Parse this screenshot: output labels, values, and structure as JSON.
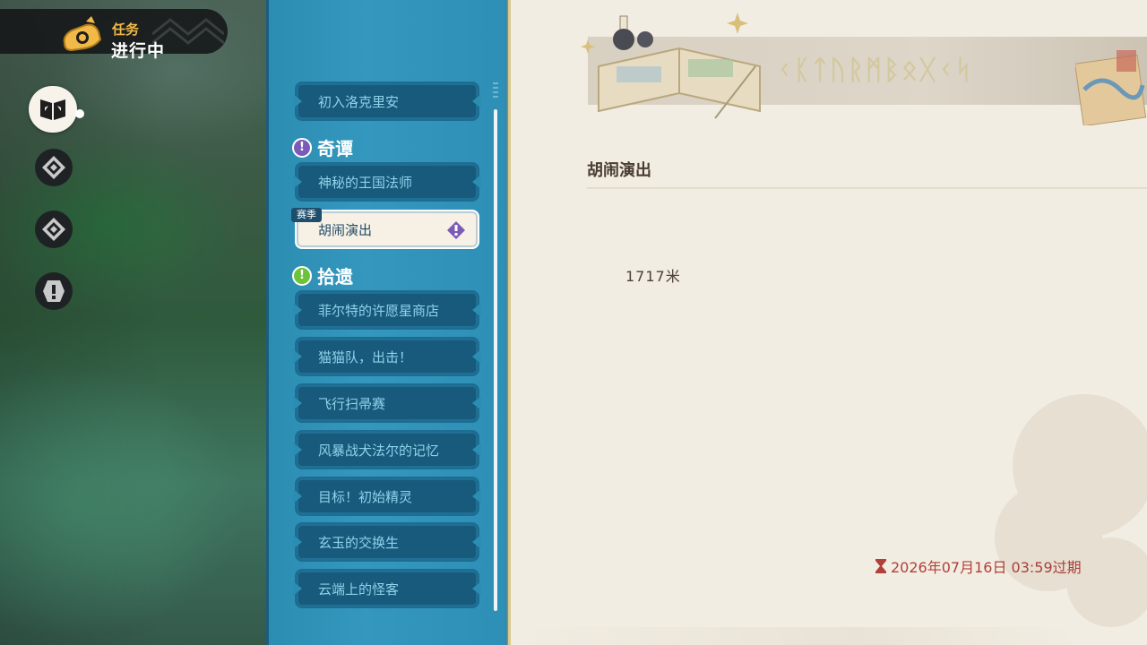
{
  "header": {
    "tag_small": "任务",
    "tag_big": "进行中"
  },
  "side_nav": [
    {
      "name": "quest-book",
      "icon": "book-icon"
    },
    {
      "name": "diamond-1",
      "icon": "diamond-compass-icon"
    },
    {
      "name": "diamond-2",
      "icon": "diamond-compass-icon"
    },
    {
      "name": "alert",
      "icon": "exclamation-icon"
    }
  ],
  "quest_list": {
    "top_item": "初入洛克里安",
    "sections": [
      {
        "title": "奇谭",
        "icon": "exclamation-icon",
        "icon_color": "#7a5bb8",
        "items": [
          "神秘的王国法师",
          "胡闹演出"
        ]
      },
      {
        "title": "拾遗",
        "icon": "exclamation-icon",
        "icon_color": "#6cc33a",
        "items": [
          "菲尔特的许愿星商店",
          "猫猫队，出击！",
          "飞行扫帚赛",
          "风暴战犬法尔的记忆",
          "目标！初始精灵",
          "玄玉的交换生",
          "云端上的怪客"
        ]
      }
    ],
    "season_tag": "赛季",
    "selected": "胡闹演出"
  },
  "detail": {
    "title": "胡闹演出",
    "distance": "1717米",
    "expire_text": "2026年07月16日 03:59过期",
    "expire_color": "#b0403a"
  },
  "colors": {
    "panel_blue": "#2c8db2",
    "item_blue": "#175a7c",
    "parchment": "#f2ede2"
  }
}
